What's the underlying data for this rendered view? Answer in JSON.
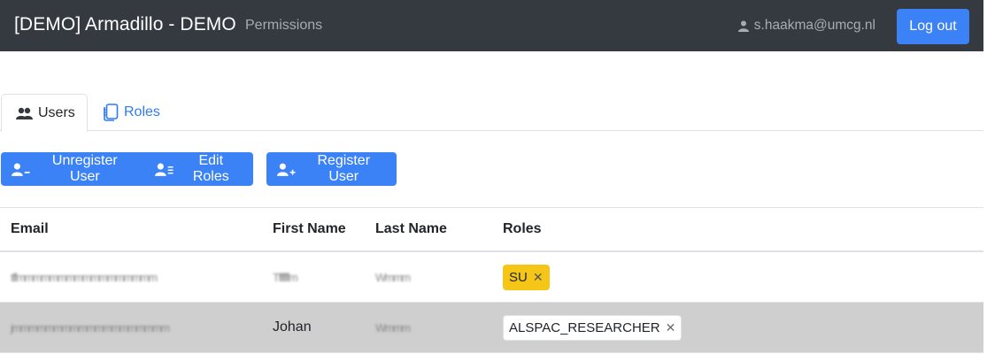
{
  "navbar": {
    "brand": "[DEMO] Armadillo - DEMO",
    "link": "Permissions",
    "user_email": "s.haakma@umcg.nl",
    "logout_label": "Log out"
  },
  "tabs": [
    {
      "label": "Users",
      "icon": "users-icon",
      "active": true
    },
    {
      "label": "Roles",
      "icon": "roles-icon",
      "active": false
    }
  ],
  "toolbar": {
    "unregister_label": "Unregister User",
    "edit_roles_label": "Edit Roles",
    "register_label": "Register User"
  },
  "table": {
    "columns": [
      "Email",
      "First Name",
      "Last Name",
      "Roles"
    ],
    "rows": [
      {
        "email": "tffmmmmmmmmmmmmmmmmm",
        "first_name": "Tffffffm",
        "last_name": "Wmmm",
        "roles": [
          "SU"
        ],
        "selected": false
      },
      {
        "email": "jmmmmmmmmmmmmmmmmmmm",
        "first_name": "Johan",
        "last_name": "Wmmm",
        "roles": [
          "ALSPAC_RESEARCHER"
        ],
        "selected": true
      }
    ]
  },
  "colors": {
    "navbar_bg": "#343a40",
    "primary": "#3b82f6",
    "link": "#2f7bf5",
    "su_badge": "#f5c518",
    "selected_row": "#cfcfcf"
  }
}
